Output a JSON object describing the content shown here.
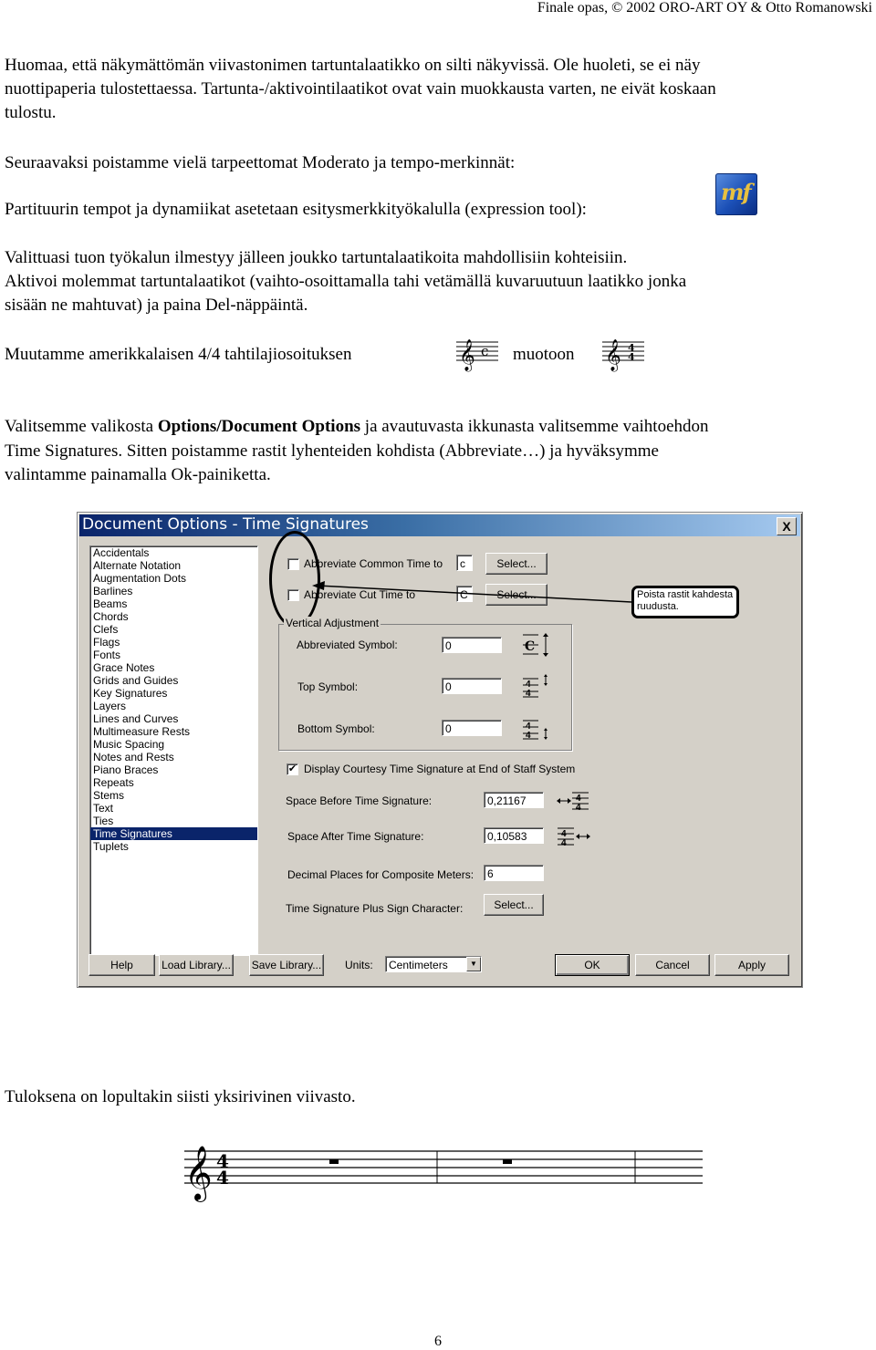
{
  "header": {
    "text": "Finale opas, © 2002 ORO-ART OY & Otto Romanowski"
  },
  "paragraphs": {
    "p1_line1": "Huomaa, että näkymättömän viivastonimen tartuntalaatikko on silti näkyvissä. Ole huoleti, se ei näy",
    "p1_line2": "nuottipaperia tulostettaessa. Tartunta-/aktivointilaatikot ovat vain muokkausta varten, ne eivät koskaan",
    "p1_line3": "tulostu.",
    "p2": "Seuraavaksi poistamme vielä tarpeettomat Moderato ja tempo-merkinnät:",
    "p3": "Partituurin tempot ja dynamiikat asetetaan esitysmerkkityökalulla (expression tool):",
    "p4_line1": "Valittuasi tuon työkalun ilmestyy jälleen joukko tartuntalaatikoita mahdollisiin kohteisiin.",
    "p4_line2": "Aktivoi molemmat tartuntalaatikot (vaihto-osoittamalla tahi vetämällä kuvaruutuun laatikko jonka",
    "p4_line3": "sisään ne mahtuvat) ja paina Del-näppäintä.",
    "p5_a": "Muutamme amerikkalaisen 4/4 tahtilajiosoituksen",
    "p5_b": "muotoon",
    "p6_line1_a": "Valitsemme valikosta ",
    "p6_line1_bold": "Options/Document Options",
    "p6_line1_b": " ja avautuvasta ikkunasta valitsemme vaihtoehdon",
    "p6_line2": "Time Signatures. Sitten poistamme rastit lyhenteiden kohdista (Abbreviate…) ja hyväksymme",
    "p6_line3": "valintamme painamalla Ok-painiketta.",
    "p7": "Tuloksena on lopultakin siisti yksirivinen viivasto."
  },
  "icons": {
    "expression_tool": "mf",
    "close": "X"
  },
  "dialog": {
    "title": "Document Options - Time Signatures",
    "list_items": [
      "Accidentals",
      "Alternate Notation",
      "Augmentation Dots",
      "Barlines",
      "Beams",
      "Chords",
      "Clefs",
      "Flags",
      "Fonts",
      "Grace Notes",
      "Grids and Guides",
      "Key Signatures",
      "Layers",
      "Lines and Curves",
      "Multimeasure Rests",
      "Music Spacing",
      "Notes and Rests",
      "Piano Braces",
      "Repeats",
      "Stems",
      "Text",
      "Ties",
      "Time Signatures",
      "Tuplets"
    ],
    "selected_item": "Time Signatures",
    "abbrev_common": {
      "label": "Abbreviate Common Time to",
      "checked": false,
      "value": "c",
      "button": "Select..."
    },
    "abbrev_cut": {
      "label": "Abbreviate Cut Time to",
      "checked": false,
      "value": "C",
      "button": "Select..."
    },
    "callout": "Poista rastit kahdesta ruudusta.",
    "vertical_adjustment": {
      "label": "Vertical Adjustment",
      "abbreviated_symbol": {
        "label": "Abbreviated Symbol:",
        "value": "0"
      },
      "top_symbol": {
        "label": "Top Symbol:",
        "value": "0"
      },
      "bottom_symbol": {
        "label": "Bottom Symbol:",
        "value": "0"
      }
    },
    "courtesy": {
      "label": "Display Courtesy Time Signature at End of Staff System",
      "checked": true,
      "mark": "✔"
    },
    "space_before": {
      "label": "Space Before Time Signature:",
      "value": "0,21167"
    },
    "space_after": {
      "label": "Space After Time Signature:",
      "value": "0,10583"
    },
    "decimal_places": {
      "label": "Decimal Places for Composite Meters:",
      "value": "6"
    },
    "plus_sign": {
      "label": "Time Signature Plus Sign Character:",
      "button": "Select..."
    },
    "buttons": {
      "help": "Help",
      "load": "Load Library...",
      "save": "Save Library...",
      "ok": "OK",
      "cancel": "Cancel",
      "apply": "Apply"
    },
    "units": {
      "label": "Units:",
      "value": "Centimeters"
    }
  },
  "footer": {
    "page_number": "6"
  }
}
